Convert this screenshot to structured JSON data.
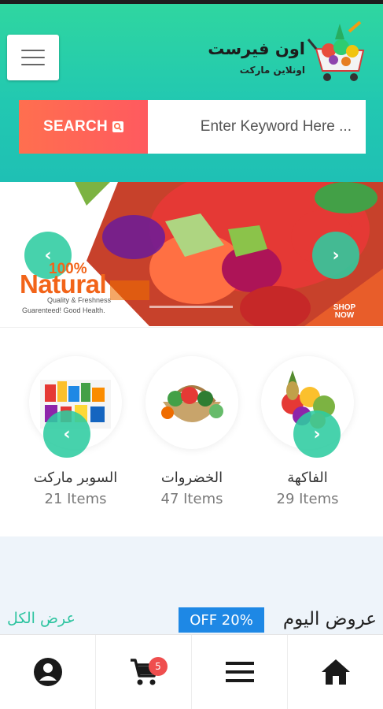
{
  "header": {
    "logo_title": "اون فيرست",
    "logo_subtitle": "اونلاين ماركت",
    "menu_icon": "hamburger-icon"
  },
  "search": {
    "button_label": "SEARCH",
    "placeholder": "Enter Keyword Here ...",
    "icon": "search-icon"
  },
  "banner": {
    "badge_percent": "100%",
    "badge_word": "Natural",
    "line1": "Quality & Freshness",
    "line2": "Guarenteed! Good Health.",
    "cta_line1": "SHOP",
    "cta_line2": "NOW",
    "prev_icon": "chevron-left-icon",
    "next_icon": "chevron-right-icon"
  },
  "categories": [
    {
      "name": "الفاكهة",
      "count": "29 Items",
      "icon": "fruits-image"
    },
    {
      "name": "الخضروات",
      "count": "47 Items",
      "icon": "vegetables-image"
    },
    {
      "name": "السوبر ماركت",
      "count": "21 Items",
      "icon": "supermarket-image"
    }
  ],
  "offers": {
    "title": "عروض اليوم",
    "badge": "OFF 20%",
    "view_all": "عرض الكل"
  },
  "bottom_nav": {
    "items": [
      {
        "icon": "account-icon"
      },
      {
        "icon": "cart-icon",
        "badge": "5"
      },
      {
        "icon": "menu-icon"
      },
      {
        "icon": "home-icon"
      }
    ]
  },
  "colors": {
    "header_gradient_top": "#2fd6a0",
    "header_gradient_bottom": "#1fc0b4",
    "search_button": "#ff6f4f",
    "accent_green": "#2ec4a0",
    "offer_badge": "#1e88e5",
    "cart_badge": "#ef4e4e"
  }
}
